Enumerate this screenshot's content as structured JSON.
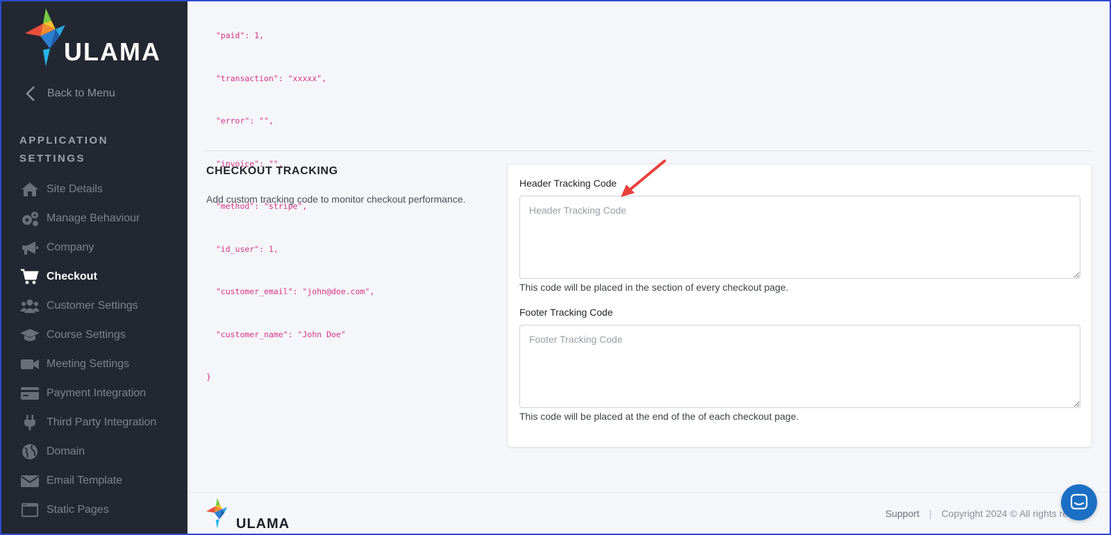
{
  "brand": {
    "name": "ULAMA"
  },
  "sidebar": {
    "back_label": "Back to Menu",
    "section_heading": "APPLICATION SETTINGS",
    "items": [
      {
        "label": "Site Details",
        "icon": "home-icon",
        "active": false
      },
      {
        "label": "Manage Behaviour",
        "icon": "gears-icon",
        "active": false
      },
      {
        "label": "Company",
        "icon": "megaphone-icon",
        "active": false
      },
      {
        "label": "Checkout",
        "icon": "cart-icon",
        "active": true
      },
      {
        "label": "Customer Settings",
        "icon": "users-icon",
        "active": false
      },
      {
        "label": "Course Settings",
        "icon": "graduation-cap-icon",
        "active": false
      },
      {
        "label": "Meeting Settings",
        "icon": "video-camera-icon",
        "active": false
      },
      {
        "label": "Payment Integration",
        "icon": "credit-card-icon",
        "active": false
      },
      {
        "label": "Third Party Integration",
        "icon": "plug-icon",
        "active": false
      },
      {
        "label": "Domain",
        "icon": "globe-icon",
        "active": false
      },
      {
        "label": "Email Template",
        "icon": "envelope-icon",
        "active": false
      },
      {
        "label": "Static Pages",
        "icon": "window-icon",
        "active": false
      }
    ]
  },
  "code_sample": {
    "lines": [
      "  \"paid\": 1,",
      "  \"transaction\": \"xxxxx\",",
      "  \"error\": \"\",",
      "  \"invoice\": \"\",",
      "  \"method\": \"stripe\",",
      "  \"id_user\": 1,",
      "  \"customer_email\": \"john@doe.com\",",
      "  \"customer_name\": \"John Doe\"",
      "}"
    ]
  },
  "checkout_tracking": {
    "title": "CHECKOUT TRACKING",
    "description": "Add custom tracking code to monitor checkout performance.",
    "header": {
      "label": "Header Tracking Code",
      "placeholder": "Header Tracking Code",
      "value": "",
      "help": "This code will be placed in the section of every checkout page."
    },
    "footer": {
      "label": "Footer Tracking Code",
      "placeholder": "Footer Tracking Code",
      "value": "",
      "help": "This code will be placed at the end of the of each checkout page."
    }
  },
  "footer": {
    "support_label": "Support",
    "separator": "|",
    "copyright": "Copyright 2024 © All rights re"
  },
  "colors": {
    "sidebar_bg": "#232731",
    "accent": "#1b6fc4",
    "code_pink": "#d63384",
    "annotation_red": "#e8403c"
  }
}
